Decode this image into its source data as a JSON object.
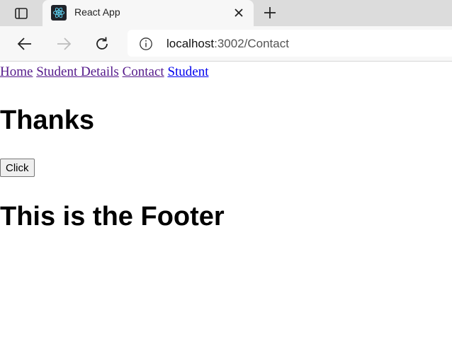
{
  "browser": {
    "tab": {
      "title": "React App",
      "favicon": "react-logo-icon"
    },
    "address": {
      "host": "localhost",
      "rest": ":3002/Contact"
    },
    "icons": {
      "tab_actions": "tab-actions-icon",
      "close": "close-icon",
      "new_tab": "plus-icon",
      "back": "back-arrow-icon",
      "forward": "forward-arrow-icon",
      "reload": "reload-icon",
      "info": "info-icon"
    },
    "colors": {
      "react_cyan": "#61dafb",
      "visited_link": "#551a8b",
      "link": "#0000ee"
    }
  },
  "page": {
    "nav": [
      {
        "label": "Home",
        "visited": true
      },
      {
        "label": "Student Details",
        "visited": true
      },
      {
        "label": "Contact",
        "visited": true
      },
      {
        "label": "Student",
        "visited": false
      }
    ],
    "heading": "Thanks",
    "button_label": "Click",
    "footer_heading": "This is the Footer"
  }
}
